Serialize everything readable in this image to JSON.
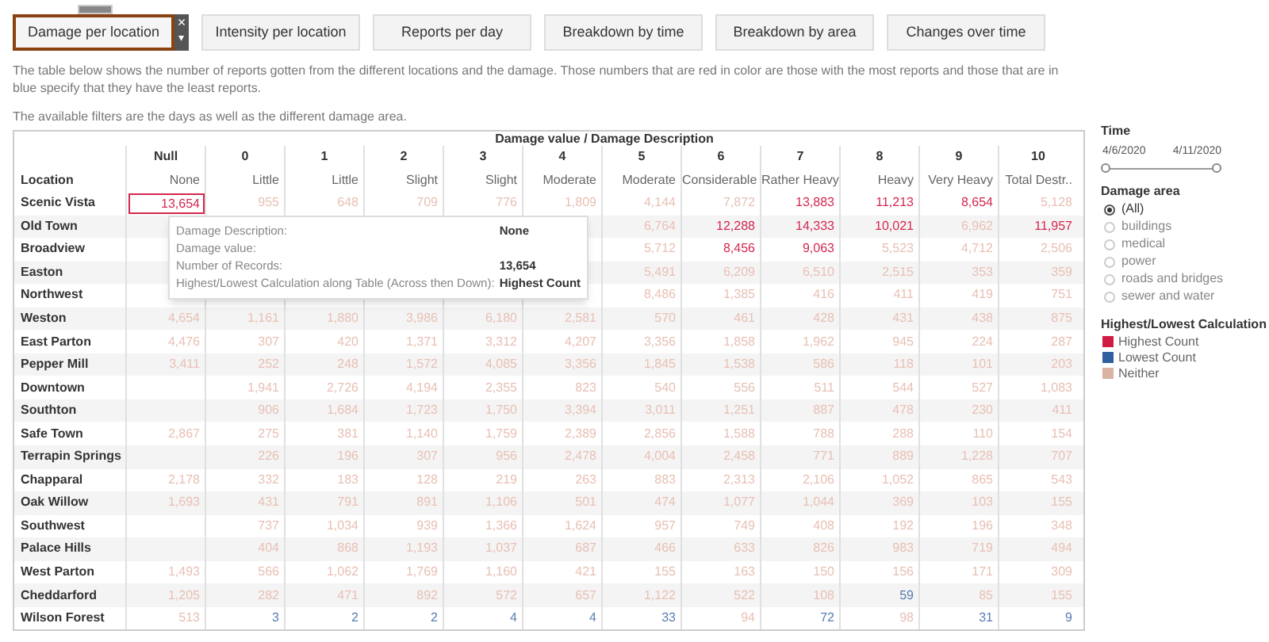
{
  "tabs": [
    {
      "label": "Damage per location",
      "selected": true
    },
    {
      "label": "Intensity per location",
      "selected": false
    },
    {
      "label": "Reports per day",
      "selected": false
    },
    {
      "label": "Breakdown by time",
      "selected": false
    },
    {
      "label": "Breakdown by area",
      "selected": false
    },
    {
      "label": "Changes over time",
      "selected": false
    }
  ],
  "tab_close": "×",
  "tab_menu": "▾",
  "description": "The table below shows the number of reports gotten from the different locations and the damage. Those numbers that are red in color are those with the most reports and those that are in blue specify that they have the least reports.",
  "filters_note": "The available filters are the days as well as the different damage area.",
  "table": {
    "title": "Damage value / Damage Description",
    "row_header": "Location",
    "columns": [
      {
        "value": "Null",
        "description": "None"
      },
      {
        "value": "0",
        "description": "Little"
      },
      {
        "value": "1",
        "description": "Little"
      },
      {
        "value": "2",
        "description": "Slight"
      },
      {
        "value": "3",
        "description": "Slight"
      },
      {
        "value": "4",
        "description": "Moderate"
      },
      {
        "value": "5",
        "description": "Moderate"
      },
      {
        "value": "6",
        "description": "Considerable"
      },
      {
        "value": "7",
        "description": "Rather Heavy"
      },
      {
        "value": "8",
        "description": "Heavy"
      },
      {
        "value": "9",
        "description": "Very Heavy"
      },
      {
        "value": "10",
        "description": "Total Destr.."
      }
    ],
    "rows": [
      {
        "location": "Scenic Vista",
        "cells": [
          {
            "v": "13,654",
            "color": "#d4284f",
            "selected": true
          },
          {
            "v": "955",
            "color": "#e8c0b4",
            "selected": false
          },
          {
            "v": "648",
            "color": "#e8c0b4",
            "selected": false
          },
          {
            "v": "709",
            "color": "#e8c0b4",
            "selected": false
          },
          {
            "v": "776",
            "color": "#e8c0b4",
            "selected": false
          },
          {
            "v": "1,809",
            "color": "#e8c0b4",
            "selected": false
          },
          {
            "v": "4,144",
            "color": "#e8c0b4",
            "selected": false
          },
          {
            "v": "7,872",
            "color": "#e8c0b4",
            "selected": false
          },
          {
            "v": "13,883",
            "color": "#d4284f",
            "selected": false
          },
          {
            "v": "11,213",
            "color": "#d4284f",
            "selected": false
          },
          {
            "v": "8,654",
            "color": "#d4284f",
            "selected": false
          },
          {
            "v": "5,128",
            "color": "#e8c0b4",
            "selected": false
          }
        ]
      },
      {
        "location": "Old Town",
        "cells": [
          null,
          null,
          null,
          null,
          null,
          null,
          {
            "v": "6,764",
            "color": "#e8c0b4",
            "selected": false
          },
          {
            "v": "12,288",
            "color": "#d4284f",
            "selected": false
          },
          {
            "v": "14,333",
            "color": "#d4284f",
            "selected": false
          },
          {
            "v": "10,021",
            "color": "#d4284f",
            "selected": false
          },
          {
            "v": "6,962",
            "color": "#e8c0b4",
            "selected": false
          },
          {
            "v": "11,957",
            "color": "#d4284f",
            "selected": false
          }
        ]
      },
      {
        "location": "Broadview",
        "cells": [
          null,
          null,
          null,
          null,
          null,
          null,
          {
            "v": "5,712",
            "color": "#e8c0b4",
            "selected": false
          },
          {
            "v": "8,456",
            "color": "#d4284f",
            "selected": false
          },
          {
            "v": "9,063",
            "color": "#d4284f",
            "selected": false
          },
          {
            "v": "5,523",
            "color": "#e8c0b4",
            "selected": false
          },
          {
            "v": "4,712",
            "color": "#e8c0b4",
            "selected": false
          },
          {
            "v": "2,506",
            "color": "#e8c0b4",
            "selected": false
          }
        ]
      },
      {
        "location": "Easton",
        "cells": [
          null,
          null,
          null,
          null,
          null,
          null,
          {
            "v": "5,491",
            "color": "#e8c0b4",
            "selected": false
          },
          {
            "v": "6,209",
            "color": "#e8c0b4",
            "selected": false
          },
          {
            "v": "6,510",
            "color": "#e8c0b4",
            "selected": false
          },
          {
            "v": "2,515",
            "color": "#e8c0b4",
            "selected": false
          },
          {
            "v": "353",
            "color": "#e8c0b4",
            "selected": false
          },
          {
            "v": "359",
            "color": "#e8c0b4",
            "selected": false
          }
        ]
      },
      {
        "location": "Northwest",
        "cells": [
          null,
          null,
          null,
          null,
          null,
          null,
          {
            "v": "8,486",
            "color": "#e8c0b4",
            "selected": false
          },
          {
            "v": "1,385",
            "color": "#e8c0b4",
            "selected": false
          },
          {
            "v": "416",
            "color": "#e8c0b4",
            "selected": false
          },
          {
            "v": "411",
            "color": "#e8c0b4",
            "selected": false
          },
          {
            "v": "419",
            "color": "#e8c0b4",
            "selected": false
          },
          {
            "v": "751",
            "color": "#e8c0b4",
            "selected": false
          }
        ]
      },
      {
        "location": "Weston",
        "cells": [
          {
            "v": "4,654",
            "color": "#e8c0b4",
            "selected": false
          },
          {
            "v": "1,161",
            "color": "#e8c0b4",
            "selected": false
          },
          {
            "v": "1,880",
            "color": "#e8c0b4",
            "selected": false
          },
          {
            "v": "3,986",
            "color": "#e8c0b4",
            "selected": false
          },
          {
            "v": "6,180",
            "color": "#e8c0b4",
            "selected": false
          },
          {
            "v": "2,581",
            "color": "#e8c0b4",
            "selected": false
          },
          {
            "v": "570",
            "color": "#e8c0b4",
            "selected": false
          },
          {
            "v": "461",
            "color": "#e8c0b4",
            "selected": false
          },
          {
            "v": "428",
            "color": "#e8c0b4",
            "selected": false
          },
          {
            "v": "431",
            "color": "#e8c0b4",
            "selected": false
          },
          {
            "v": "438",
            "color": "#e8c0b4",
            "selected": false
          },
          {
            "v": "875",
            "color": "#e8c0b4",
            "selected": false
          }
        ]
      },
      {
        "location": "East Parton",
        "cells": [
          {
            "v": "4,476",
            "color": "#e8c0b4",
            "selected": false
          },
          {
            "v": "307",
            "color": "#e8c0b4",
            "selected": false
          },
          {
            "v": "420",
            "color": "#e8c0b4",
            "selected": false
          },
          {
            "v": "1,371",
            "color": "#e8c0b4",
            "selected": false
          },
          {
            "v": "3,312",
            "color": "#e8c0b4",
            "selected": false
          },
          {
            "v": "4,207",
            "color": "#e8c0b4",
            "selected": false
          },
          {
            "v": "3,356",
            "color": "#e8c0b4",
            "selected": false
          },
          {
            "v": "1,858",
            "color": "#e8c0b4",
            "selected": false
          },
          {
            "v": "1,962",
            "color": "#e8c0b4",
            "selected": false
          },
          {
            "v": "945",
            "color": "#e8c0b4",
            "selected": false
          },
          {
            "v": "224",
            "color": "#e8c0b4",
            "selected": false
          },
          {
            "v": "287",
            "color": "#e8c0b4",
            "selected": false
          }
        ]
      },
      {
        "location": "Pepper Mill",
        "cells": [
          {
            "v": "3,411",
            "color": "#e8c0b4",
            "selected": false
          },
          {
            "v": "252",
            "color": "#e8c0b4",
            "selected": false
          },
          {
            "v": "248",
            "color": "#e8c0b4",
            "selected": false
          },
          {
            "v": "1,572",
            "color": "#e8c0b4",
            "selected": false
          },
          {
            "v": "4,085",
            "color": "#e8c0b4",
            "selected": false
          },
          {
            "v": "3,356",
            "color": "#e8c0b4",
            "selected": false
          },
          {
            "v": "1,845",
            "color": "#e8c0b4",
            "selected": false
          },
          {
            "v": "1,538",
            "color": "#e8c0b4",
            "selected": false
          },
          {
            "v": "586",
            "color": "#e8c0b4",
            "selected": false
          },
          {
            "v": "118",
            "color": "#e8c0b4",
            "selected": false
          },
          {
            "v": "101",
            "color": "#e8c0b4",
            "selected": false
          },
          {
            "v": "203",
            "color": "#e8c0b4",
            "selected": false
          }
        ]
      },
      {
        "location": "Downtown",
        "cells": [
          null,
          {
            "v": "1,941",
            "color": "#e8c0b4",
            "selected": false
          },
          {
            "v": "2,726",
            "color": "#e8c0b4",
            "selected": false
          },
          {
            "v": "4,194",
            "color": "#e8c0b4",
            "selected": false
          },
          {
            "v": "2,355",
            "color": "#e8c0b4",
            "selected": false
          },
          {
            "v": "823",
            "color": "#e8c0b4",
            "selected": false
          },
          {
            "v": "540",
            "color": "#e8c0b4",
            "selected": false
          },
          {
            "v": "556",
            "color": "#e8c0b4",
            "selected": false
          },
          {
            "v": "511",
            "color": "#e8c0b4",
            "selected": false
          },
          {
            "v": "544",
            "color": "#e8c0b4",
            "selected": false
          },
          {
            "v": "527",
            "color": "#e8c0b4",
            "selected": false
          },
          {
            "v": "1,083",
            "color": "#e8c0b4",
            "selected": false
          }
        ]
      },
      {
        "location": "Southton",
        "cells": [
          null,
          {
            "v": "906",
            "color": "#e8c0b4",
            "selected": false
          },
          {
            "v": "1,684",
            "color": "#e8c0b4",
            "selected": false
          },
          {
            "v": "1,723",
            "color": "#e8c0b4",
            "selected": false
          },
          {
            "v": "1,750",
            "color": "#e8c0b4",
            "selected": false
          },
          {
            "v": "3,394",
            "color": "#e8c0b4",
            "selected": false
          },
          {
            "v": "3,011",
            "color": "#e8c0b4",
            "selected": false
          },
          {
            "v": "1,251",
            "color": "#e8c0b4",
            "selected": false
          },
          {
            "v": "887",
            "color": "#e8c0b4",
            "selected": false
          },
          {
            "v": "478",
            "color": "#e8c0b4",
            "selected": false
          },
          {
            "v": "230",
            "color": "#e8c0b4",
            "selected": false
          },
          {
            "v": "411",
            "color": "#e8c0b4",
            "selected": false
          }
        ]
      },
      {
        "location": "Safe Town",
        "cells": [
          {
            "v": "2,867",
            "color": "#e8c0b4",
            "selected": false
          },
          {
            "v": "275",
            "color": "#e8c0b4",
            "selected": false
          },
          {
            "v": "381",
            "color": "#e8c0b4",
            "selected": false
          },
          {
            "v": "1,140",
            "color": "#e8c0b4",
            "selected": false
          },
          {
            "v": "1,759",
            "color": "#e8c0b4",
            "selected": false
          },
          {
            "v": "2,389",
            "color": "#e8c0b4",
            "selected": false
          },
          {
            "v": "2,856",
            "color": "#e8c0b4",
            "selected": false
          },
          {
            "v": "1,588",
            "color": "#e8c0b4",
            "selected": false
          },
          {
            "v": "788",
            "color": "#e8c0b4",
            "selected": false
          },
          {
            "v": "288",
            "color": "#e8c0b4",
            "selected": false
          },
          {
            "v": "110",
            "color": "#e8c0b4",
            "selected": false
          },
          {
            "v": "154",
            "color": "#e8c0b4",
            "selected": false
          }
        ]
      },
      {
        "location": "Terrapin Springs",
        "cells": [
          null,
          {
            "v": "226",
            "color": "#e8c0b4",
            "selected": false
          },
          {
            "v": "196",
            "color": "#e8c0b4",
            "selected": false
          },
          {
            "v": "307",
            "color": "#e8c0b4",
            "selected": false
          },
          {
            "v": "956",
            "color": "#e8c0b4",
            "selected": false
          },
          {
            "v": "2,478",
            "color": "#e8c0b4",
            "selected": false
          },
          {
            "v": "4,004",
            "color": "#e8c0b4",
            "selected": false
          },
          {
            "v": "2,458",
            "color": "#e8c0b4",
            "selected": false
          },
          {
            "v": "771",
            "color": "#e8c0b4",
            "selected": false
          },
          {
            "v": "889",
            "color": "#e8c0b4",
            "selected": false
          },
          {
            "v": "1,228",
            "color": "#e8c0b4",
            "selected": false
          },
          {
            "v": "707",
            "color": "#e8c0b4",
            "selected": false
          }
        ]
      },
      {
        "location": "Chapparal",
        "cells": [
          {
            "v": "2,178",
            "color": "#e8c0b4",
            "selected": false
          },
          {
            "v": "332",
            "color": "#e8c0b4",
            "selected": false
          },
          {
            "v": "183",
            "color": "#e8c0b4",
            "selected": false
          },
          {
            "v": "128",
            "color": "#e8c0b4",
            "selected": false
          },
          {
            "v": "219",
            "color": "#e8c0b4",
            "selected": false
          },
          {
            "v": "263",
            "color": "#e8c0b4",
            "selected": false
          },
          {
            "v": "883",
            "color": "#e8c0b4",
            "selected": false
          },
          {
            "v": "2,313",
            "color": "#e8c0b4",
            "selected": false
          },
          {
            "v": "2,106",
            "color": "#e8c0b4",
            "selected": false
          },
          {
            "v": "1,052",
            "color": "#e8c0b4",
            "selected": false
          },
          {
            "v": "865",
            "color": "#e8c0b4",
            "selected": false
          },
          {
            "v": "543",
            "color": "#e8c0b4",
            "selected": false
          }
        ]
      },
      {
        "location": "Oak Willow",
        "cells": [
          {
            "v": "1,693",
            "color": "#e8c0b4",
            "selected": false
          },
          {
            "v": "431",
            "color": "#e8c0b4",
            "selected": false
          },
          {
            "v": "791",
            "color": "#e8c0b4",
            "selected": false
          },
          {
            "v": "891",
            "color": "#e8c0b4",
            "selected": false
          },
          {
            "v": "1,106",
            "color": "#e8c0b4",
            "selected": false
          },
          {
            "v": "501",
            "color": "#e8c0b4",
            "selected": false
          },
          {
            "v": "474",
            "color": "#e8c0b4",
            "selected": false
          },
          {
            "v": "1,077",
            "color": "#e8c0b4",
            "selected": false
          },
          {
            "v": "1,044",
            "color": "#e8c0b4",
            "selected": false
          },
          {
            "v": "369",
            "color": "#e8c0b4",
            "selected": false
          },
          {
            "v": "103",
            "color": "#e8c0b4",
            "selected": false
          },
          {
            "v": "155",
            "color": "#e8c0b4",
            "selected": false
          }
        ]
      },
      {
        "location": "Southwest",
        "cells": [
          null,
          {
            "v": "737",
            "color": "#e8c0b4",
            "selected": false
          },
          {
            "v": "1,034",
            "color": "#e8c0b4",
            "selected": false
          },
          {
            "v": "939",
            "color": "#e8c0b4",
            "selected": false
          },
          {
            "v": "1,366",
            "color": "#e8c0b4",
            "selected": false
          },
          {
            "v": "1,624",
            "color": "#e8c0b4",
            "selected": false
          },
          {
            "v": "957",
            "color": "#e8c0b4",
            "selected": false
          },
          {
            "v": "749",
            "color": "#e8c0b4",
            "selected": false
          },
          {
            "v": "408",
            "color": "#e8c0b4",
            "selected": false
          },
          {
            "v": "192",
            "color": "#e8c0b4",
            "selected": false
          },
          {
            "v": "196",
            "color": "#e8c0b4",
            "selected": false
          },
          {
            "v": "348",
            "color": "#e8c0b4",
            "selected": false
          }
        ]
      },
      {
        "location": "Palace Hills",
        "cells": [
          null,
          {
            "v": "404",
            "color": "#e8c0b4",
            "selected": false
          },
          {
            "v": "868",
            "color": "#e8c0b4",
            "selected": false
          },
          {
            "v": "1,193",
            "color": "#e8c0b4",
            "selected": false
          },
          {
            "v": "1,037",
            "color": "#e8c0b4",
            "selected": false
          },
          {
            "v": "687",
            "color": "#e8c0b4",
            "selected": false
          },
          {
            "v": "466",
            "color": "#e8c0b4",
            "selected": false
          },
          {
            "v": "633",
            "color": "#e8c0b4",
            "selected": false
          },
          {
            "v": "826",
            "color": "#e8c0b4",
            "selected": false
          },
          {
            "v": "983",
            "color": "#e8c0b4",
            "selected": false
          },
          {
            "v": "719",
            "color": "#e8c0b4",
            "selected": false
          },
          {
            "v": "494",
            "color": "#e8c0b4",
            "selected": false
          }
        ]
      },
      {
        "location": "West Parton",
        "cells": [
          {
            "v": "1,493",
            "color": "#e8c0b4",
            "selected": false
          },
          {
            "v": "566",
            "color": "#e8c0b4",
            "selected": false
          },
          {
            "v": "1,062",
            "color": "#e8c0b4",
            "selected": false
          },
          {
            "v": "1,769",
            "color": "#e8c0b4",
            "selected": false
          },
          {
            "v": "1,160",
            "color": "#e8c0b4",
            "selected": false
          },
          {
            "v": "421",
            "color": "#e8c0b4",
            "selected": false
          },
          {
            "v": "155",
            "color": "#e8c0b4",
            "selected": false
          },
          {
            "v": "163",
            "color": "#e8c0b4",
            "selected": false
          },
          {
            "v": "150",
            "color": "#e8c0b4",
            "selected": false
          },
          {
            "v": "156",
            "color": "#e8c0b4",
            "selected": false
          },
          {
            "v": "171",
            "color": "#e8c0b4",
            "selected": false
          },
          {
            "v": "309",
            "color": "#e8c0b4",
            "selected": false
          }
        ]
      },
      {
        "location": "Cheddarford",
        "cells": [
          {
            "v": "1,205",
            "color": "#e8c0b4",
            "selected": false
          },
          {
            "v": "282",
            "color": "#e8c0b4",
            "selected": false
          },
          {
            "v": "471",
            "color": "#e8c0b4",
            "selected": false
          },
          {
            "v": "892",
            "color": "#e8c0b4",
            "selected": false
          },
          {
            "v": "572",
            "color": "#e8c0b4",
            "selected": false
          },
          {
            "v": "657",
            "color": "#e8c0b4",
            "selected": false
          },
          {
            "v": "1,122",
            "color": "#e8c0b4",
            "selected": false
          },
          {
            "v": "522",
            "color": "#e8c0b4",
            "selected": false
          },
          {
            "v": "108",
            "color": "#e8c0b4",
            "selected": false
          },
          {
            "v": "59",
            "color": "#5a7db0",
            "selected": false
          },
          {
            "v": "85",
            "color": "#e8c0b4",
            "selected": false
          },
          {
            "v": "155",
            "color": "#e8c0b4",
            "selected": false
          }
        ]
      },
      {
        "location": "Wilson Forest",
        "cells": [
          {
            "v": "513",
            "color": "#e8c0b4",
            "selected": false
          },
          {
            "v": "3",
            "color": "#5a7db0",
            "selected": false
          },
          {
            "v": "2",
            "color": "#5a7db0",
            "selected": false
          },
          {
            "v": "2",
            "color": "#5a7db0",
            "selected": false
          },
          {
            "v": "4",
            "color": "#5a7db0",
            "selected": false
          },
          {
            "v": "4",
            "color": "#5a7db0",
            "selected": false
          },
          {
            "v": "33",
            "color": "#5a7db0",
            "selected": false
          },
          {
            "v": "94",
            "color": "#e8c0b4",
            "selected": false
          },
          {
            "v": "72",
            "color": "#5a7db0",
            "selected": false
          },
          {
            "v": "98",
            "color": "#e8c0b4",
            "selected": false
          },
          {
            "v": "31",
            "color": "#5a7db0",
            "selected": false
          },
          {
            "v": "9",
            "color": "#5a7db0",
            "selected": false
          }
        ]
      }
    ]
  },
  "tooltip": [
    {
      "label": "Damage Description:",
      "value": "None"
    },
    {
      "label": "Damage value:"
    },
    {
      "label": "Number of Records:",
      "value": "13,654"
    },
    {
      "label": "Highest/Lowest Calculation along Table (Across then Down):",
      "value": "Highest Count"
    }
  ],
  "time_filter": {
    "title": "Time",
    "start": "4/6/2020",
    "end": "4/11/2020",
    "thumbs": [
      {
        "level": 0
      },
      {
        "level": 1
      }
    ]
  },
  "damage_area": {
    "title": "Damage area",
    "options": [
      {
        "label": "(All)",
        "selected": true
      },
      {
        "label": "buildings",
        "selected": false
      },
      {
        "label": "medical",
        "selected": false
      },
      {
        "label": "power",
        "selected": false
      },
      {
        "label": "roads and bridges",
        "selected": false
      },
      {
        "label": "sewer and water",
        "selected": false
      }
    ]
  },
  "legend": {
    "title": "Highest/Lowest Calculation",
    "items": [
      {
        "label": "Highest Count",
        "color": "#d01c45"
      },
      {
        "label": "Lowest Count",
        "color": "#2f5f9f"
      },
      {
        "label": "Neither",
        "color": "#d9b3a3"
      }
    ]
  }
}
